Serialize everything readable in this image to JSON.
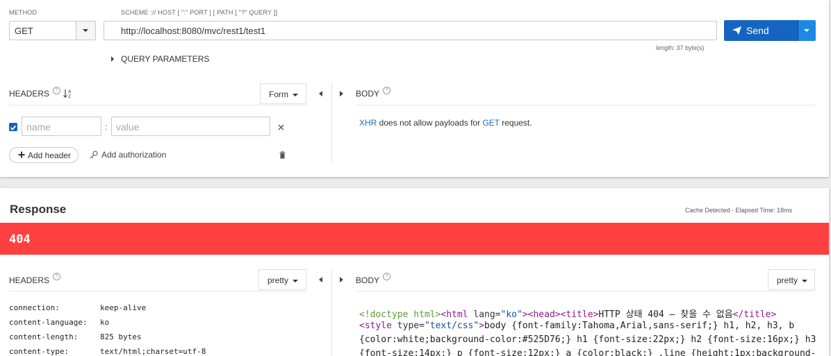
{
  "request": {
    "method_label": "METHOD",
    "method_value": "GET",
    "url_label": "SCHEME :// HOST [ \":\" PORT ] [ PATH [ \"?\" QUERY ]]",
    "url_value": "http://localhost:8080/mvc/rest1/test1",
    "url_length": "length: 37 byte(s)",
    "send_label": "Send",
    "query_params_label": "QUERY PARAMETERS",
    "headers": {
      "title": "HEADERS",
      "help": "?",
      "sort_icon_text": "↓",
      "mode": "Form",
      "name_placeholder": "name",
      "value_placeholder": "value",
      "separator": ":",
      "add_header": "Add header",
      "add_authorization": "Add authorization"
    },
    "body": {
      "title": "BODY",
      "help": "?",
      "message_xhr": "XHR",
      "message_mid": " does not allow payloads for ",
      "message_method": "GET",
      "message_end": " request."
    }
  },
  "response": {
    "title": "Response",
    "meta": "Cache Detected - Elapsed Time: 18ms",
    "status_code": "404",
    "headers": {
      "title": "HEADERS",
      "help": "?",
      "mode": "pretty",
      "rows": [
        {
          "key": "connection:",
          "value": "keep-alive"
        },
        {
          "key": "content-language:",
          "value": "ko"
        },
        {
          "key": "content-length:",
          "value": "825 bytes"
        },
        {
          "key": "content-type:",
          "value": "text/html;charset=utf-8"
        }
      ]
    },
    "body": {
      "title": "BODY",
      "help": "?",
      "mode": "pretty",
      "code": {
        "l1_doctype": "<!doctype html>",
        "l1_html_open": "<html ",
        "l1_lang_attr": "lang=",
        "l1_lang_val": "\"ko\"",
        "l1_close": ">",
        "l1_head_title": "<head><title>",
        "l1_text": "HTTP 상태 404 – 찾을 수 없음",
        "l1_title_close": "</title>",
        "l2_style_open": "<style ",
        "l2_type_attr": "type=",
        "l2_type_val": "\"text/css\"",
        "l2_close": ">",
        "l2_text": "body {font-family:Tahoma,Arial,sans-serif;} h1, h2, h3, b",
        "l3_text": "{color:white;background-color:#525D76;} h1 {font-size:22px;} h2 {font-size:16px;} h3",
        "l4_text": "{font-size:14px;} p {font-size:12px;} a {color:black;} .line {height:1px;background-"
      }
    }
  },
  "colors": {
    "accent": "#1565c0",
    "error": "#ff4040",
    "link": "#1a6fb5"
  }
}
